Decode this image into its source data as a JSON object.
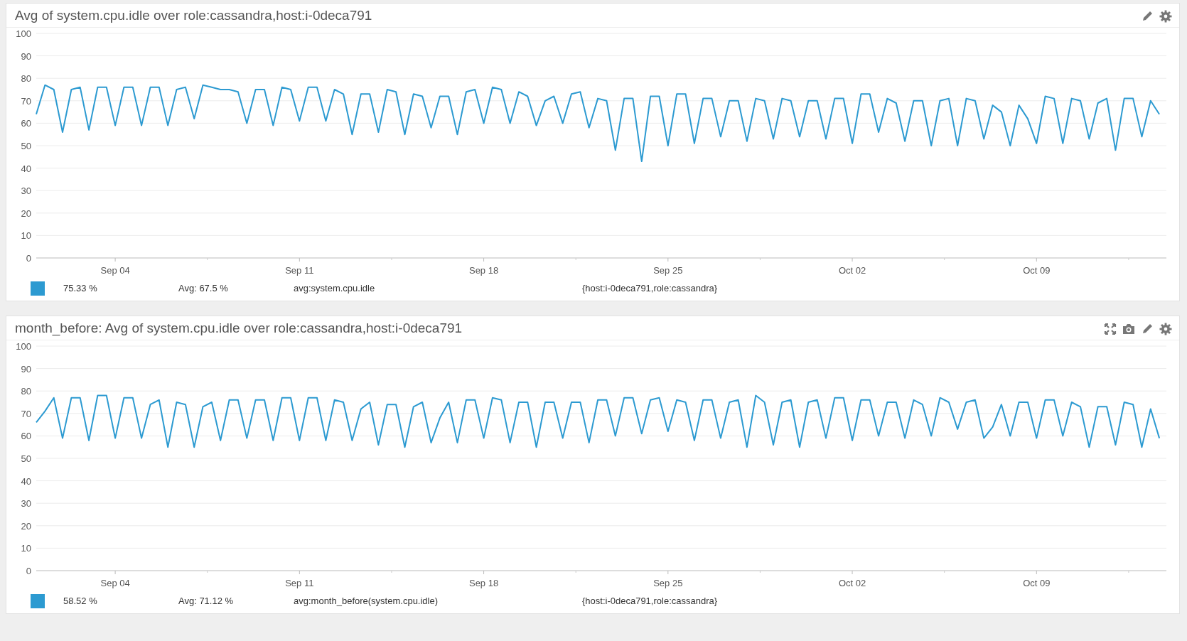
{
  "panels": [
    {
      "title": "Avg of system.cpu.idle over role:cassandra,host:i-0deca791",
      "tools": [
        {
          "kind": "edit"
        },
        {
          "kind": "settings"
        }
      ],
      "chart_data": {
        "type": "line",
        "grid": true,
        "ylim": [
          0,
          100
        ],
        "yticks": [
          0,
          10,
          20,
          30,
          40,
          50,
          60,
          70,
          80,
          90,
          100
        ],
        "categories": [
          null,
          null,
          null,
          null,
          null,
          null,
          null,
          null,
          null,
          "Sep 04",
          null,
          null,
          null,
          null,
          null,
          null,
          null,
          null,
          null,
          null,
          null,
          null,
          null,
          null,
          null,
          null,
          null,
          null,
          null,
          null,
          "Sep 11",
          null,
          null,
          null,
          null,
          null,
          null,
          null,
          null,
          null,
          null,
          null,
          null,
          null,
          null,
          null,
          null,
          null,
          null,
          null,
          null,
          "Sep 18",
          null,
          null,
          null,
          null,
          null,
          null,
          null,
          null,
          null,
          null,
          null,
          null,
          null,
          null,
          null,
          null,
          null,
          null,
          null,
          null,
          "Sep 25",
          null,
          null,
          null,
          null,
          null,
          null,
          null,
          null,
          null,
          null,
          null,
          null,
          null,
          null,
          null,
          null,
          null,
          null,
          null,
          null,
          "Oct 02",
          null,
          null,
          null,
          null,
          null,
          null,
          null,
          null,
          null,
          null,
          null,
          null,
          null,
          null,
          null,
          null,
          null,
          null,
          null,
          null,
          "Oct 09",
          null,
          null,
          null,
          null,
          null,
          null,
          null,
          null,
          null,
          null,
          null,
          null,
          null,
          null
        ],
        "series": [
          {
            "name": "avg:system.cpu.idle",
            "color": "#2c9ad1",
            "values": [
              64,
              77,
              75,
              56,
              75,
              76,
              57,
              76,
              76,
              59,
              76,
              76,
              59,
              76,
              76,
              59,
              75,
              76,
              62,
              77,
              76,
              75,
              75,
              74,
              60,
              75,
              75,
              59,
              76,
              75,
              61,
              76,
              76,
              61,
              75,
              73,
              55,
              73,
              73,
              56,
              75,
              74,
              55,
              73,
              72,
              58,
              72,
              72,
              55,
              74,
              75,
              60,
              76,
              75,
              60,
              74,
              72,
              59,
              70,
              72,
              60,
              73,
              74,
              58,
              71,
              70,
              48,
              71,
              71,
              43,
              72,
              72,
              50,
              73,
              73,
              51,
              71,
              71,
              54,
              70,
              70,
              52,
              71,
              70,
              53,
              71,
              70,
              54,
              70,
              70,
              53,
              71,
              71,
              51,
              73,
              73,
              56,
              71,
              69,
              52,
              70,
              70,
              50,
              70,
              71,
              50,
              71,
              70,
              53,
              68,
              65,
              50,
              68,
              62,
              51,
              72,
              71,
              51,
              71,
              70,
              53,
              69,
              71,
              48,
              71,
              71,
              54,
              70,
              64
            ]
          }
        ]
      },
      "legend": {
        "value": "75.33 %",
        "avg": "Avg: 67.5 %",
        "tags": "{host:i-0deca791,role:cassandra}"
      }
    },
    {
      "title": "month_before: Avg of system.cpu.idle over role:cassandra,host:i-0deca791",
      "tools": [
        {
          "kind": "expand"
        },
        {
          "kind": "camera"
        },
        {
          "kind": "edit"
        },
        {
          "kind": "settings"
        }
      ],
      "chart_data": {
        "type": "line",
        "grid": true,
        "ylim": [
          0,
          100
        ],
        "yticks": [
          0,
          10,
          20,
          30,
          40,
          50,
          60,
          70,
          80,
          90,
          100
        ],
        "categories": [
          null,
          null,
          null,
          null,
          null,
          null,
          null,
          null,
          null,
          "Sep 04",
          null,
          null,
          null,
          null,
          null,
          null,
          null,
          null,
          null,
          null,
          null,
          null,
          null,
          null,
          null,
          null,
          null,
          null,
          null,
          null,
          "Sep 11",
          null,
          null,
          null,
          null,
          null,
          null,
          null,
          null,
          null,
          null,
          null,
          null,
          null,
          null,
          null,
          null,
          null,
          null,
          null,
          null,
          "Sep 18",
          null,
          null,
          null,
          null,
          null,
          null,
          null,
          null,
          null,
          null,
          null,
          null,
          null,
          null,
          null,
          null,
          null,
          null,
          null,
          null,
          "Sep 25",
          null,
          null,
          null,
          null,
          null,
          null,
          null,
          null,
          null,
          null,
          null,
          null,
          null,
          null,
          null,
          null,
          null,
          null,
          null,
          null,
          "Oct 02",
          null,
          null,
          null,
          null,
          null,
          null,
          null,
          null,
          null,
          null,
          null,
          null,
          null,
          null,
          null,
          null,
          null,
          null,
          null,
          null,
          "Oct 09",
          null,
          null,
          null,
          null,
          null,
          null,
          null,
          null,
          null,
          null,
          null,
          null,
          null,
          null
        ],
        "series": [
          {
            "name": "avg:month_before(system.cpu.idle)",
            "color": "#2c9ad1",
            "values": [
              66,
              71,
              77,
              59,
              77,
              77,
              58,
              78,
              78,
              59,
              77,
              77,
              59,
              74,
              76,
              55,
              75,
              74,
              55,
              73,
              75,
              58,
              76,
              76,
              59,
              76,
              76,
              58,
              77,
              77,
              58,
              77,
              77,
              58,
              76,
              75,
              58,
              72,
              75,
              56,
              74,
              74,
              55,
              73,
              75,
              57,
              68,
              75,
              57,
              76,
              76,
              59,
              77,
              76,
              57,
              75,
              75,
              55,
              75,
              75,
              59,
              75,
              75,
              57,
              76,
              76,
              60,
              77,
              77,
              61,
              76,
              77,
              62,
              76,
              75,
              58,
              76,
              76,
              59,
              75,
              76,
              55,
              78,
              75,
              56,
              75,
              76,
              55,
              75,
              76,
              59,
              77,
              77,
              58,
              76,
              76,
              60,
              75,
              75,
              59,
              76,
              74,
              60,
              77,
              75,
              63,
              75,
              76,
              59,
              64,
              74,
              60,
              75,
              75,
              59,
              76,
              76,
              60,
              75,
              73,
              55,
              73,
              73,
              56,
              75,
              74,
              55,
              72,
              59
            ]
          }
        ]
      },
      "legend": {
        "value": "58.52 %",
        "avg": "Avg: 71.12 %",
        "tags": "{host:i-0deca791,role:cassandra}"
      }
    }
  ]
}
